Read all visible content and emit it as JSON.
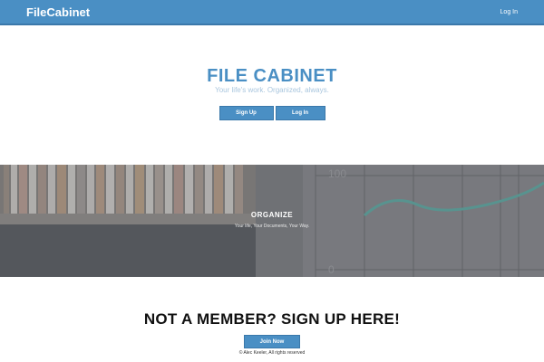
{
  "navbar": {
    "brand": "FileCabinet",
    "login_link": "Log In",
    "color": "#4a8fc4"
  },
  "hero": {
    "title": "FILE CABINET",
    "tagline": "Your life's work. Organized, always.",
    "signup_label": "Sign Up",
    "login_label": "Log In"
  },
  "feature_band": {
    "heading": "ORGANIZE",
    "subtext": "Your life, Your Documents, Your Way.",
    "chart_label_top": "100",
    "chart_label_bottom": "0"
  },
  "cta": {
    "heading": "NOT A MEMBER? SIGN UP HERE!",
    "button_label": "Join Now"
  },
  "footer": {
    "text": "© Alec Keeler, All rights reserved"
  }
}
